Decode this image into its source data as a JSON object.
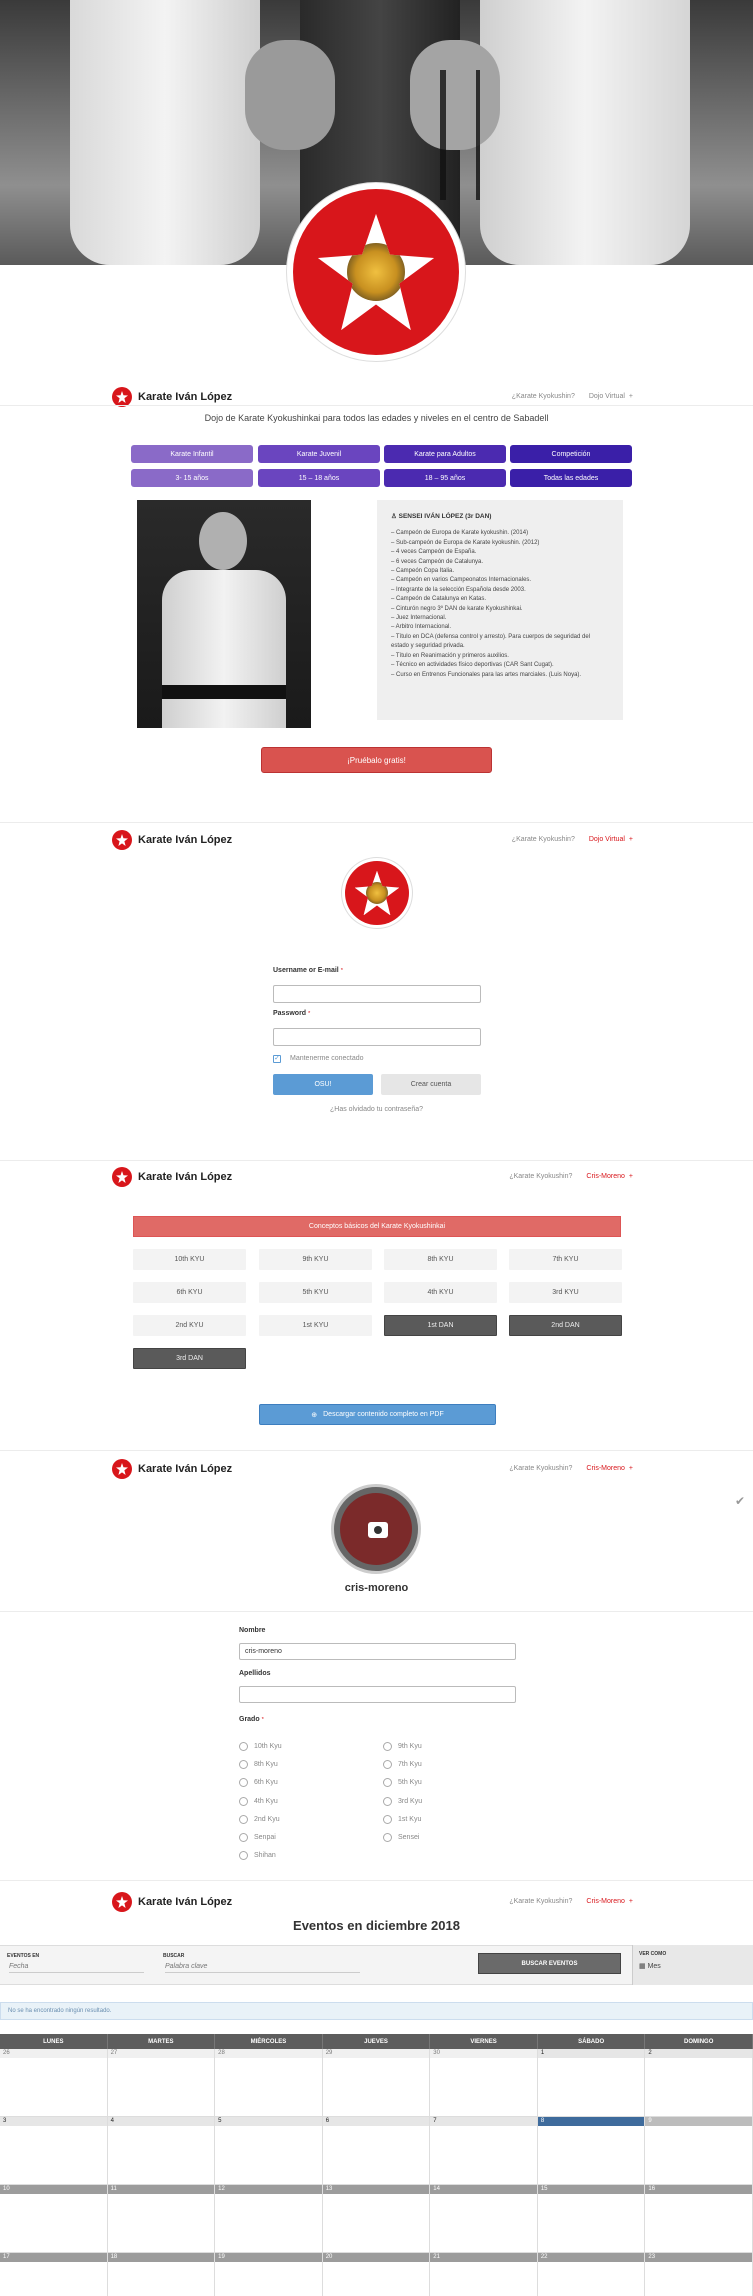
{
  "site": {
    "brand": "Karate Iván López"
  },
  "section2": {
    "nav": [
      "¿Karate Kyokushin?",
      "Dojo Virtual",
      "+"
    ],
    "tagline": "Dojo de Karate Kyokushinkai para todos las edades y niveles en el centro de Sabadell",
    "categories": [
      {
        "name": "Karate Infantil",
        "age": "3- 15 años"
      },
      {
        "name": "Karate Juvenil",
        "age": "15 – 18 años"
      },
      {
        "name": "Karate para Adultos",
        "age": "18 – 95 años"
      },
      {
        "name": "Competición",
        "age": "Todas las edades"
      }
    ],
    "bio_title": "SENSEI IVÁN LÓPEZ (3r DAN)",
    "bio_lines": [
      "– Campeón de Europa de Karate kyokushin. (2014)",
      "– Sub-campeón de Europa de Karate kyokushin. (2012)",
      "– 4 veces Campeón de España.",
      "– 6 veces Campeón de Catalunya.",
      "– Campeón Copa Italia.",
      "– Campeón en varios Campeonatos Internacionales.",
      "– Integrante de la selección Española desde 2003.",
      "– Campeón de Catalunya en Katas.",
      "– Cinturón negro 3º DAN de karate Kyokushinkai.",
      "– Juez Internacional.",
      "– Arbitro Internacional.",
      "– Título en DCA    (defensa control y arresto). Para cuerpos de seguridad del estado y seguridad privada.",
      "– Título en Reanimación y primeros auxilios.",
      "– Técnico en actividades físico deportivas (CAR Sant Cugat).",
      "– Curso en Entrenos Funcionales para las artes marciales. (Luis Noya)."
    ],
    "cta": "¡Pruébalo gratis!"
  },
  "section3": {
    "nav": [
      "¿Karate Kyokushin?",
      "Dojo Virtual",
      "+"
    ],
    "username_label": "Username or E-mail",
    "password_label": "Password",
    "required_mark": "*",
    "remember": "Mantenerme conectado",
    "login_btn": "OSU!",
    "register_btn": "Crear cuenta",
    "forgot": "¿Has olvidado tu contraseña?",
    "check_mark": "✓"
  },
  "section4": {
    "nav": [
      "¿Karate Kyokushin?",
      "Cris-Moreno",
      "+"
    ],
    "banner": "Conceptos básicos del Karate Kyokushinkai",
    "belts": [
      "10th KYU",
      "9th KYU",
      "8th KYU",
      "7th KYU",
      "6th KYU",
      "5th KYU",
      "4th KYU",
      "3rd KYU",
      "2nd KYU",
      "1st KYU",
      "1st DAN",
      "2nd DAN",
      "3rd DAN"
    ],
    "pdf_btn": "Descargar contenido completo en PDF",
    "pdf_icon": "⊕"
  },
  "section5": {
    "nav": [
      "¿Karate Kyokushin?",
      "Cris-Moreno",
      "+"
    ],
    "username": "cris-moreno",
    "name_label": "Nombre",
    "name_value": "cris-moreno",
    "surname_label": "Apellidos",
    "surname_value": "",
    "grade_label": "Grado",
    "required_mark": "*",
    "grades_left": [
      "10th Kyu",
      "8th Kyu",
      "6th Kyu",
      "4th Kyu",
      "2nd Kyu",
      "Senpai",
      "Shihan"
    ],
    "grades_right": [
      "9th Kyu",
      "7th Kyu",
      "5th Kyu",
      "3rd Kyu",
      "1st Kyu",
      "Sensei"
    ],
    "side_check": "✔"
  },
  "section6": {
    "nav": [
      "¿Karate Kyokushin?",
      "Cris-Moreno",
      "+"
    ],
    "title": "Eventos en diciembre 2018",
    "events_in_label": "EVENTOS EN",
    "events_in_placeholder": "Fecha",
    "search_label": "BUSCAR",
    "search_placeholder": "Palabra clave",
    "search_btn": "BUSCAR EVENTOS",
    "view_as_label": "VER COMO",
    "view_as_value": "Mes",
    "no_results": "No se ha encontrado ningún resultado.",
    "weekdays": [
      "LUNES",
      "MARTES",
      "MIÉRCOLES",
      "JUEVES",
      "VIERNES",
      "SÁBADO",
      "DOMINGO"
    ],
    "week1": [
      "26",
      "27",
      "28",
      "29",
      "30",
      "1",
      "2"
    ],
    "week2": [
      "3",
      "4",
      "5",
      "6",
      "7",
      "8",
      "9"
    ],
    "week3": [
      "10",
      "11",
      "12",
      "13",
      "14",
      "15",
      "16"
    ],
    "week4": [
      "17",
      "18",
      "19",
      "20",
      "21",
      "22",
      "23"
    ]
  }
}
